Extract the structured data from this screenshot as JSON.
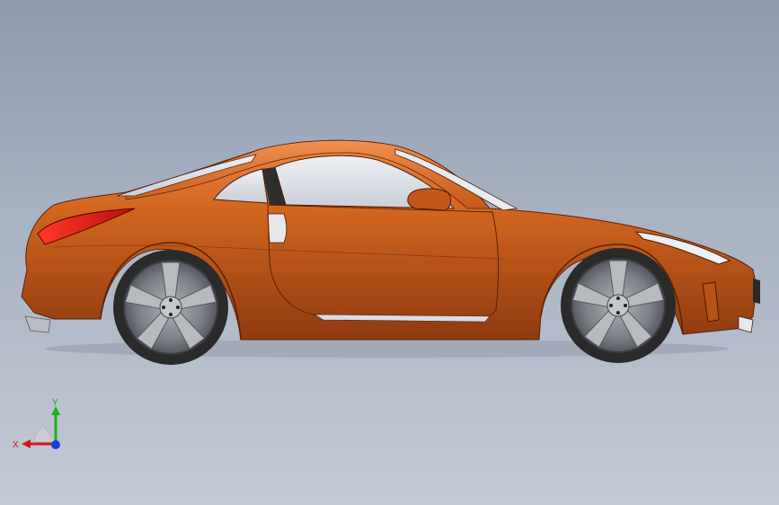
{
  "viewport": {
    "background_top": "#8d99ae",
    "background_bottom": "#c4cad6"
  },
  "model": {
    "body_color": "#d2651e",
    "body_shadow": "#a24414",
    "body_highlight": "#e88a48",
    "glass_color": "#dfe3ea",
    "tail_light_color": "#e01818",
    "tire_color": "#2a2a2a",
    "rim_color": "#8c8f94"
  },
  "triad": {
    "x_label": "X",
    "y_label": "Y",
    "x_color": "#d41818",
    "y_color": "#18b418",
    "z_color": "#1a3cd8"
  }
}
